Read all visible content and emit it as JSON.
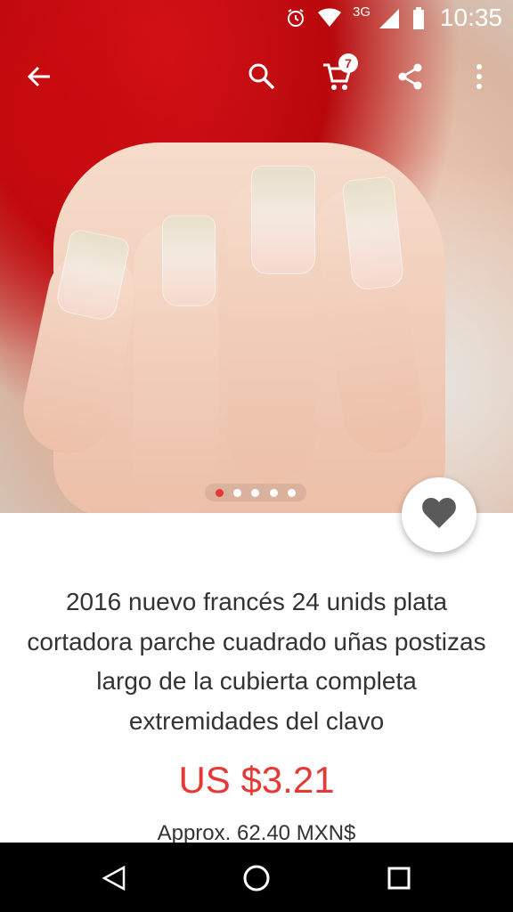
{
  "status_bar": {
    "time": "10:35",
    "network": "3G",
    "icons": [
      "alarm-icon",
      "wifi-icon",
      "signal-icon",
      "battery-icon"
    ]
  },
  "toolbar": {
    "icons": [
      "back-arrow-icon",
      "search-icon",
      "cart-icon",
      "share-icon",
      "more-vert-icon"
    ],
    "cart_count": "7"
  },
  "gallery": {
    "image": "product-photo-nails",
    "page_count": 5,
    "active_page": 1
  },
  "product": {
    "title": "2016 nuevo francés 24 unids plata cortadora parche cuadrado uñas postizas largo de la cubierta completa extremidades del clavo",
    "price": "US $3.21",
    "approx": "Approx. 62.40 MXN$"
  },
  "nav_bar": {
    "icons": [
      "back-triangle-icon",
      "home-circle-icon",
      "recents-square-icon"
    ]
  },
  "colors": {
    "accent": "#e53935",
    "text": "#333333"
  }
}
